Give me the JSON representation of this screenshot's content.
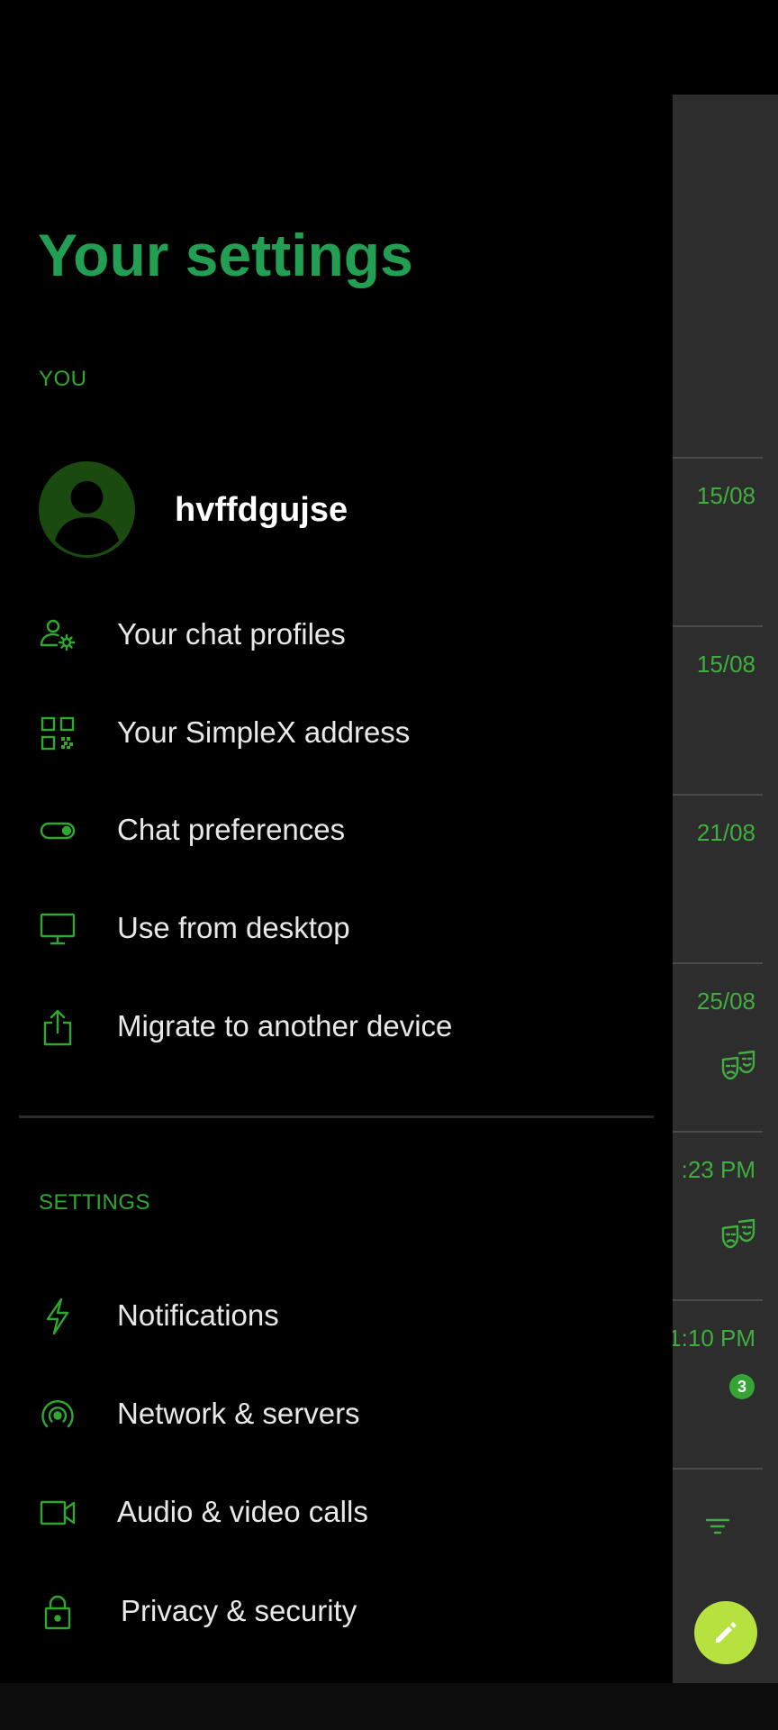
{
  "drawer": {
    "title": "Your settings",
    "you_section_label": "YOU",
    "profile": {
      "name": "hvffdgujse"
    },
    "you_items": [
      {
        "label": "Your chat profiles",
        "icon": "user-gear-icon"
      },
      {
        "label": "Your SimpleX address",
        "icon": "qr-code-icon"
      },
      {
        "label": "Chat preferences",
        "icon": "toggle-icon"
      },
      {
        "label": "Use from desktop",
        "icon": "desktop-icon"
      },
      {
        "label": "Migrate to another device",
        "icon": "share-upload-icon"
      }
    ],
    "settings_section_label": "SETTINGS",
    "settings_items": [
      {
        "label": "Notifications",
        "icon": "bolt-icon"
      },
      {
        "label": "Network & servers",
        "icon": "wifi-tethering-icon"
      },
      {
        "label": "Audio & video calls",
        "icon": "video-camera-icon"
      },
      {
        "label": "Privacy & security",
        "icon": "lock-icon"
      }
    ]
  },
  "chat_list": {
    "rows": [
      {
        "time": "15/08"
      },
      {
        "time": "15/08"
      },
      {
        "time": "21/08"
      },
      {
        "time": "25/08",
        "icon": "incognito-masks-icon"
      },
      {
        "time": ":23 PM",
        "icon": "incognito-masks-icon"
      },
      {
        "time": "1:10 PM",
        "unread": "3"
      }
    ],
    "filter_icon": "filter-icon",
    "compose_icon": "pencil-icon"
  },
  "colors": {
    "accent_green": "#229f52",
    "icon_green": "#2ea92e",
    "fab": "#b6e13f",
    "badge": "#36a335",
    "panel": "#2d2d2d"
  }
}
